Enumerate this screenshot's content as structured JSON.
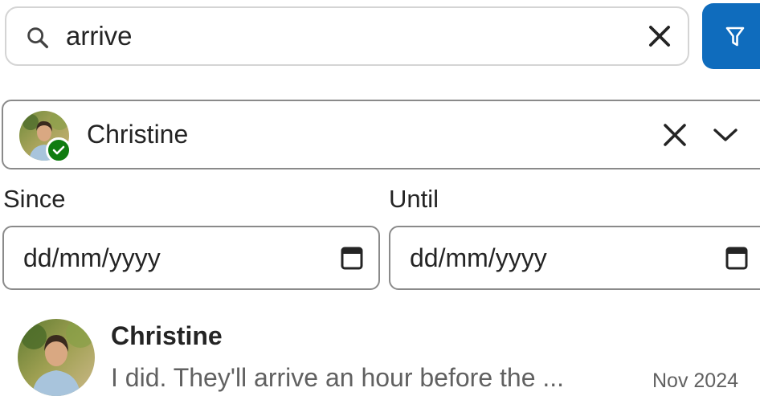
{
  "search": {
    "query": "arrive",
    "icons": {
      "search": "search-icon",
      "clear": "close-icon"
    }
  },
  "filter_button": {
    "icon": "filter-icon",
    "color": "#0f6cbd"
  },
  "person_picker": {
    "selected_name": "Christine",
    "status": "available",
    "status_color": "#107c10",
    "icons": {
      "clear": "close-icon",
      "expand": "chevron-down-icon"
    }
  },
  "date_filters": {
    "since": {
      "label": "Since",
      "placeholder": "dd/mm/yyyy",
      "icon": "calendar-icon"
    },
    "until": {
      "label": "Until",
      "placeholder": "dd/mm/yyyy",
      "icon": "calendar-icon"
    }
  },
  "results": [
    {
      "sender": "Christine",
      "preview": "I did. They'll arrive an hour before the ...",
      "date": "Nov 2024"
    }
  ]
}
